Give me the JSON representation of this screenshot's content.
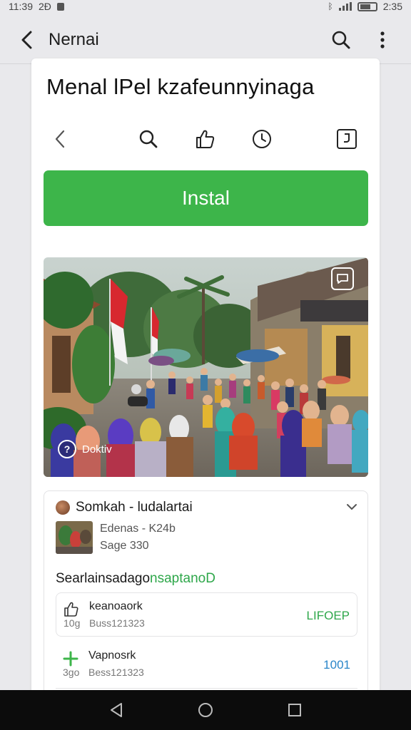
{
  "status": {
    "time": "11:39",
    "carrier": "2Ð",
    "clock": "2:35"
  },
  "app_bar": {
    "title": "Nernai"
  },
  "page": {
    "title": "Menal lPel kzafeunnyinaga",
    "install_label": "Instal"
  },
  "hero": {
    "badge_text": "Doktiv"
  },
  "developer": {
    "name": "Somkah - ludalartai",
    "meta_line_1": "Edenas - K24b",
    "meta_line_2": "Sage 330"
  },
  "section": {
    "label_main": "Searlainsadago",
    "label_accent": "nsaptanoD"
  },
  "stats": [
    {
      "label": "keanoaork",
      "sub": "10g",
      "detail": "Buss121323",
      "value": "LIFOEP",
      "value_color": "#2ea74a"
    },
    {
      "label": "Vapnosrk",
      "sub": "3go",
      "detail": "Bess121323",
      "value": "1001",
      "value_color": "#2a86c9"
    }
  ],
  "colors": {
    "accent_green": "#3db54a",
    "nav_bar": "#0c0c0c",
    "background": "#e9e9ec"
  }
}
